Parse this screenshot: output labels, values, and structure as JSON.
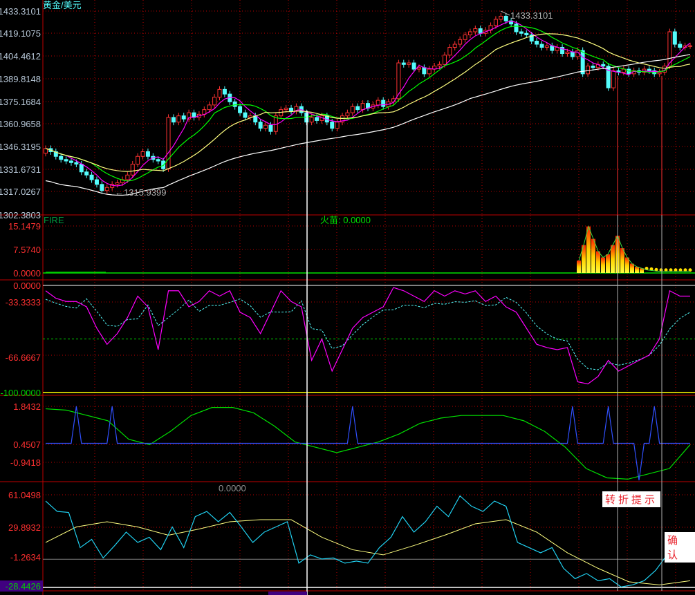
{
  "title": "黄金/美元",
  "colors": {
    "up": "#ff3232",
    "down": "#54fcfc",
    "ma1": "#ff00ff",
    "ma2": "#00ff00",
    "ma3": "#ffff80",
    "ma4": "#ffffff",
    "grid": "#c00000",
    "axis_price": "#b8c8d8",
    "axis_red": "#ff3030",
    "axis_green": "#00d000"
  },
  "main": {
    "axis_labels": [
      "1433.3101",
      "1419.1075",
      "1404.4612",
      "1389.8148",
      "1375.1684",
      "1360.9658",
      "1346.3195",
      "1331.6731",
      "1317.0267",
      "1302.3803"
    ],
    "high_label": "1433.3101",
    "low_label": "←1315.9399"
  },
  "fire": {
    "name": "FIRE",
    "readout": "火苗: 0.0000",
    "axis_labels": [
      "15.1479",
      "7.5740",
      "0.0000"
    ]
  },
  "wr": {
    "axis_labels": [
      "0.0000",
      "-33.3333",
      "-66.6667",
      "-100.0000"
    ]
  },
  "osc": {
    "axis_labels": [
      "1.8432",
      "0.4507",
      "-0.9418"
    ]
  },
  "trend": {
    "readout": "0.0000",
    "axis_labels": [
      "61.0498",
      "29.8932",
      "-1.2634",
      "-28.4426"
    ]
  },
  "notes": {
    "turn": "转折提示",
    "confirm": "确认"
  },
  "chart_data": [
    {
      "type": "candlestick",
      "title": "黄金/美元",
      "ylim": [
        1302.3803,
        1433.3101
      ],
      "close": [
        1345,
        1343,
        1340,
        1338,
        1337,
        1336,
        1335,
        1330,
        1328,
        1325,
        1322,
        1318,
        1320,
        1322,
        1323,
        1325,
        1328,
        1335,
        1340,
        1343,
        1340,
        1338,
        1337,
        1332,
        1365,
        1362,
        1366,
        1364,
        1368,
        1365,
        1367,
        1370,
        1373,
        1378,
        1383,
        1380,
        1375,
        1372,
        1368,
        1365,
        1366,
        1362,
        1358,
        1360,
        1356,
        1366,
        1370,
        1371,
        1369,
        1372,
        1368,
        1362,
        1365,
        1363,
        1366,
        1362,
        1358,
        1362,
        1366,
        1368,
        1372,
        1370,
        1374,
        1371,
        1373,
        1376,
        1372,
        1375,
        1377,
        1400,
        1399,
        1400,
        1396,
        1397,
        1393,
        1396,
        1398,
        1399,
        1405,
        1410,
        1412,
        1415,
        1418,
        1420,
        1422,
        1419,
        1421,
        1424,
        1428,
        1430,
        1427,
        1425,
        1420,
        1419,
        1418,
        1414,
        1412,
        1410,
        1411,
        1408,
        1410,
        1406,
        1407,
        1404,
        1408,
        1393,
        1398,
        1397,
        1399,
        1398,
        1384,
        1395,
        1394,
        1396,
        1393,
        1395,
        1394,
        1396,
        1395,
        1393,
        1394,
        1398,
        1420,
        1412,
        1410,
        1411,
        1411
      ],
      "moving_averages": [
        5,
        10,
        20,
        60
      ]
    },
    {
      "type": "bar",
      "title": "FIRE",
      "ylim": [
        0,
        15.1479
      ],
      "values_last": [
        4,
        9,
        15,
        11,
        7,
        5,
        6,
        9,
        12,
        8,
        5,
        3,
        2,
        1.5,
        1,
        0.8,
        0.6,
        0.5,
        0.5,
        0.5,
        0.5,
        0.5,
        0.5,
        0.5
      ]
    },
    {
      "type": "line",
      "ylim": [
        -100,
        0
      ],
      "reference": -50,
      "values": [
        -5,
        -12,
        -15,
        -15,
        -20,
        -40,
        -55,
        -45,
        -30,
        -10,
        -20,
        -60,
        -5,
        -5,
        -20,
        -15,
        -5,
        -10,
        -5,
        -25,
        -30,
        -45,
        -25,
        -5,
        -15,
        -20,
        -70,
        -50,
        -80,
        -60,
        -40,
        -30,
        -25,
        -20,
        -2,
        -5,
        -10,
        -15,
        -5,
        -10,
        -5,
        -8,
        -5,
        -15,
        -10,
        -20,
        -25,
        -40,
        -55,
        -58,
        -60,
        -58,
        -90,
        -92,
        -85,
        -70,
        -80,
        -75,
        -70,
        -65,
        -50,
        -5,
        -10,
        -10
      ]
    },
    {
      "type": "line",
      "ylim": [
        -0.9418,
        1.8432
      ],
      "green": [
        1.75,
        1.7,
        1.5,
        1.3,
        0.6,
        0.4,
        0.9,
        1.5,
        1.8,
        1.8,
        1.6,
        1.1,
        0.5,
        0.3,
        0.1,
        0.3,
        0.5,
        0.8,
        1.2,
        1.4,
        1.5,
        1.5,
        1.5,
        1.3,
        0.9,
        0.3,
        -0.5,
        -0.85,
        -0.9,
        -0.7,
        -0.5,
        0.4
      ],
      "blue_base": 0.4507,
      "blue_spikes_up": [
        6,
        13,
        60,
        103,
        110,
        119
      ],
      "blue_spikes_down": [
        116
      ]
    },
    {
      "type": "line",
      "ylim": [
        -28.4426,
        61.0498
      ],
      "reference": -1.2634,
      "cyan": [
        55,
        45,
        44,
        10,
        18,
        0,
        12,
        25,
        15,
        20,
        8,
        30,
        10,
        40,
        45,
        35,
        44,
        30,
        15,
        25,
        30,
        35,
        -5,
        3,
        -1,
        0,
        -5,
        -3,
        -5,
        10,
        20,
        40,
        25,
        35,
        50,
        40,
        60,
        50,
        45,
        55,
        50,
        15,
        10,
        5,
        10,
        -10,
        -20,
        -15,
        -22,
        -20,
        -28,
        -26,
        -22,
        -12,
        3,
        2,
        5
      ],
      "yellow": [
        15,
        30,
        35,
        30,
        22,
        28,
        35,
        37,
        37,
        20,
        8,
        3,
        12,
        22,
        33,
        37,
        25,
        5,
        -10,
        -23,
        -26,
        -22
      ]
    }
  ]
}
